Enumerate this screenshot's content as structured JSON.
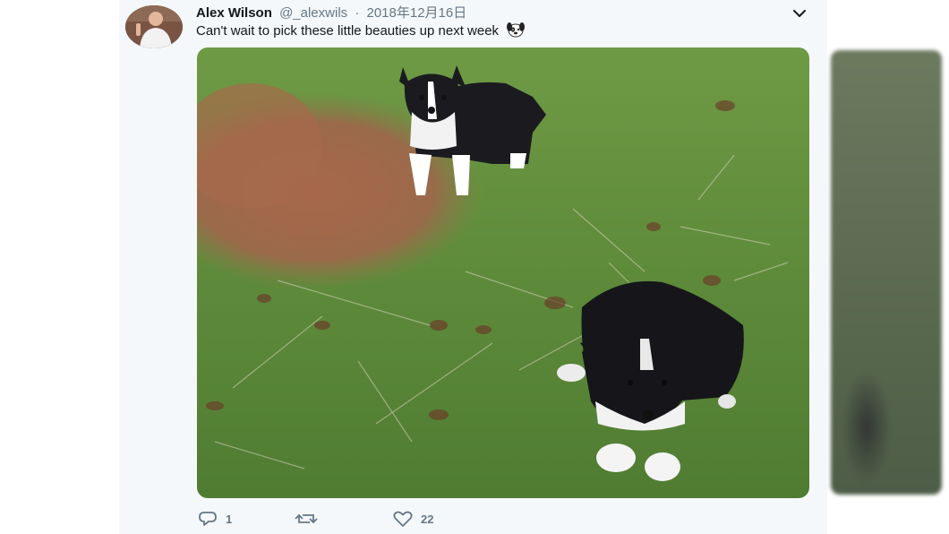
{
  "tweet": {
    "display_name": "Alex Wilson",
    "handle": "@_alexwils",
    "separator": "·",
    "date": "2018年12月16日",
    "text": "Can't wait to pick these little beauties up next week",
    "emoji": "dog-face-emoji",
    "photo_subject": "two-black-and-white-puppies-on-grass"
  },
  "actions": {
    "reply_count": "1",
    "retweet_count": "",
    "like_count": "22"
  },
  "icons": {
    "caret": "chevron-down-icon",
    "reply": "reply-icon",
    "retweet": "retweet-icon",
    "like": "heart-icon"
  },
  "colors": {
    "card_background": "#f5f8fa",
    "secondary_text": "#657786",
    "primary_text": "#14171a",
    "grass": "#5e8d3a",
    "soil": "#a8674a"
  }
}
